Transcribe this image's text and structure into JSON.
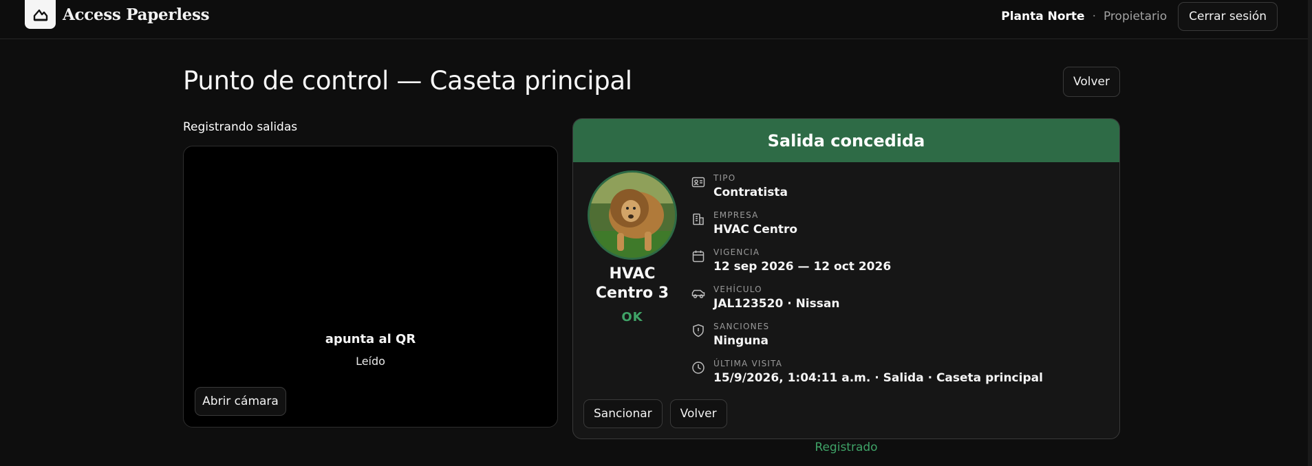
{
  "app": {
    "name": "Access Paperless"
  },
  "nav": {
    "org": "Planta Norte",
    "separator": "·",
    "role": "Propietario",
    "logout_label": "Cerrar sesión"
  },
  "page": {
    "title": "Punto de control — Caseta principal",
    "back_label": "Volver"
  },
  "scanner": {
    "mode_label": "Registrando salidas",
    "hint": "apunta al QR",
    "status": "Leído",
    "open_camera_label": "Abrir cámara"
  },
  "result": {
    "header": "Salida concedida",
    "header_color": "#2e6b46",
    "person_name": "HVAC Centro 3",
    "person_status": "OK",
    "fields": [
      {
        "icon": "id-card-icon",
        "label": "TIPO",
        "value": "Contratista"
      },
      {
        "icon": "building-icon",
        "label": "EMPRESA",
        "value": "HVAC Centro"
      },
      {
        "icon": "calendar-icon",
        "label": "VIGENCIA",
        "value": "12 sep 2026 — 12 oct 2026"
      },
      {
        "icon": "car-icon",
        "label": "VEHÍCULO",
        "value": "JAL123520 · Nissan"
      },
      {
        "icon": "shield-icon",
        "label": "SANCIONES",
        "value": "Ninguna"
      },
      {
        "icon": "clock-icon",
        "label": "ÚLTIMA VISITA",
        "value": "15/9/2026, 1:04:11 a.m. · Salida · Caseta principal"
      }
    ],
    "actions": {
      "sanction_label": "Sancionar",
      "back_label": "Volver"
    },
    "footer_status": "Registrado",
    "ok_color": "#3fa367"
  }
}
